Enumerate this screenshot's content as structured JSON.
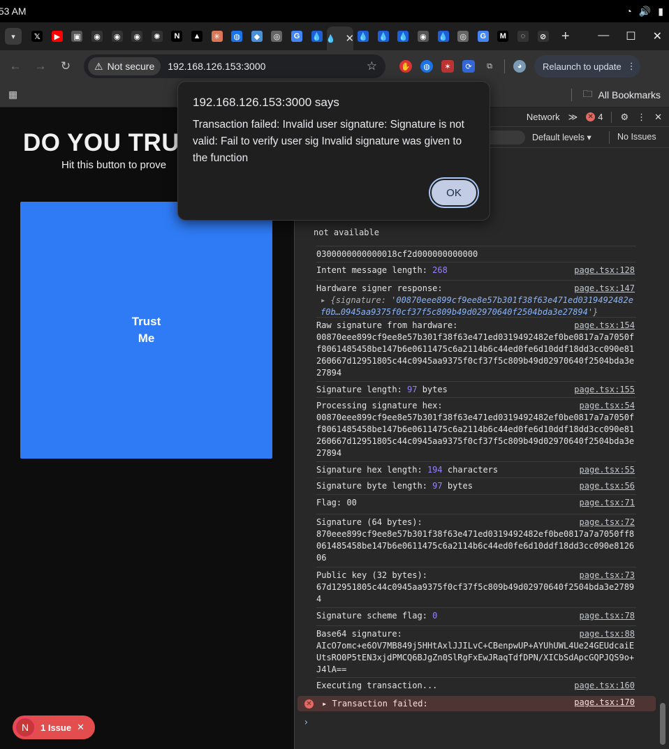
{
  "system": {
    "time": ":53 AM"
  },
  "browser": {
    "tabs": [
      {
        "icon": "chevron-down-icon"
      },
      {
        "icon": "x-icon",
        "glyph": "𝕏",
        "color": "#000"
      },
      {
        "icon": "youtube-icon",
        "glyph": "▶",
        "color": "#ff0000"
      },
      {
        "icon": "app-icon",
        "glyph": "▣",
        "color": "#555"
      },
      {
        "icon": "github-icon",
        "glyph": "◉",
        "color": "#333"
      },
      {
        "icon": "github-icon",
        "glyph": "◉",
        "color": "#333"
      },
      {
        "icon": "github-icon",
        "glyph": "◉",
        "color": "#333"
      },
      {
        "icon": "openai-icon",
        "glyph": "✺",
        "color": "#333"
      },
      {
        "icon": "nextjs-icon",
        "glyph": "N",
        "color": "#000"
      },
      {
        "icon": "vercel-icon",
        "glyph": "▲",
        "color": "#000"
      },
      {
        "icon": "claude-icon",
        "glyph": "✳",
        "color": "#d97757"
      },
      {
        "icon": "app-icon",
        "glyph": "◍",
        "color": "#1a73e8"
      },
      {
        "icon": "app-icon",
        "glyph": "◆",
        "color": "#4a90d9"
      },
      {
        "icon": "chrome-icon",
        "glyph": "◎",
        "color": "#666"
      },
      {
        "icon": "google-icon",
        "glyph": "G",
        "color": "#4285f4"
      },
      {
        "icon": "drop-icon",
        "glyph": "💧",
        "color": "#1e5fd8"
      }
    ],
    "active_tab_icon": "drop-icon",
    "address": {
      "security_label": "Not secure",
      "url": "192.168.126.153:3000"
    },
    "relaunch_label": "Relaunch to update",
    "bookmarks_label": "All Bookmarks"
  },
  "page": {
    "heading": "DO YOU TRUS",
    "subheading": "Hit this button to prove",
    "trust_button": {
      "line1": "Trust",
      "line2": "Me"
    },
    "issue_badge": {
      "letter": "N",
      "label": "1 Issue"
    }
  },
  "devtools": {
    "network_tab": "Network",
    "error_count": "4",
    "levels_label": "Default levels",
    "issues_label": "No Issues",
    "not_available": "not available",
    "logs": [
      {
        "text": "0300000000000018cf2d000000000000",
        "link": ""
      },
      {
        "prefix": "Intent message length: ",
        "num": "268",
        "suffix": "",
        "link": "page.tsx:128"
      },
      {
        "text": "Hardware signer response:",
        "link": "page.tsx:147",
        "obj_key": "signature: ",
        "obj_val": "'00870eee899cf9ee8e57b301f38f63e471ed0319492482ef0b…0945aa9375f0cf37f5c809b49d02970640f2504bda3e27894'"
      },
      {
        "text": "Raw signature from hardware:\n00870eee899cf9ee8e57b301f38f63e471ed0319492482ef0be0817a7a7050ff8061485458be147b6e0611475c6a2114b6c44ed0fe6d10ddf18dd3cc090e81260667d12951805c44c0945aa9375f0cf37f5c809b49d02970640f2504bda3e27894",
        "link": "page.tsx:154"
      },
      {
        "prefix": "Signature length: ",
        "num": "97",
        "suffix": " bytes",
        "link": "page.tsx:155"
      },
      {
        "text": "Processing signature hex:\n00870eee899cf9ee8e57b301f38f63e471ed0319492482ef0be0817a7a7050ff8061485458be147b6e0611475c6a2114b6c44ed0fe6d10ddf18dd3cc090e81260667d12951805c44c0945aa9375f0cf37f5c809b49d02970640f2504bda3e27894",
        "link": "page.tsx:54"
      },
      {
        "prefix": "Signature hex length: ",
        "num": "194",
        "suffix": " characters",
        "link": "page.tsx:55"
      },
      {
        "prefix": "Signature byte length: ",
        "num": "97",
        "suffix": " bytes",
        "link": "page.tsx:56"
      },
      {
        "text": "Flag: 00",
        "link": "page.tsx:71"
      },
      {
        "text": "Signature (64 bytes):\n870eee899cf9ee8e57b301f38f63e471ed0319492482ef0be0817a7a7050ff8061485458be147b6e0611475c6a2114b6c44ed0fe6d10ddf18dd3cc090e8126 06",
        "link": "page.tsx:72"
      },
      {
        "text": "Public key (32 bytes):\n67d12951805c44c0945aa9375f0cf37f5c809b49d02970640f2504bda3e2789 4",
        "link": "page.tsx:73"
      },
      {
        "prefix": "Signature scheme flag: ",
        "num": "0",
        "suffix": "",
        "link": "page.tsx:78"
      },
      {
        "text": "Base64 signature:\nAIcO7omc+e6OV7MB849j5HHtAxlJJILvC+CBenpwUP+AYUhUWL4Ue24GEUdcaiEUtsRO0P5tEN3xjdPMCQ6BJgZn0SlRgFxEwJRaqTdfDPN/XICbSdApcGQPJQS9o+J4lA==",
        "link": "page.tsx:88"
      },
      {
        "text": "Executing transaction...",
        "link": "page.tsx:160"
      }
    ],
    "error": {
      "text": "Transaction failed:",
      "link": "page.tsx:170"
    }
  },
  "dialog": {
    "title": "192.168.126.153:3000 says",
    "message": "Transaction failed: Invalid user signature: Signature is not valid: Fail to verify user sig Invalid signature was given to the function",
    "ok_label": "OK"
  }
}
